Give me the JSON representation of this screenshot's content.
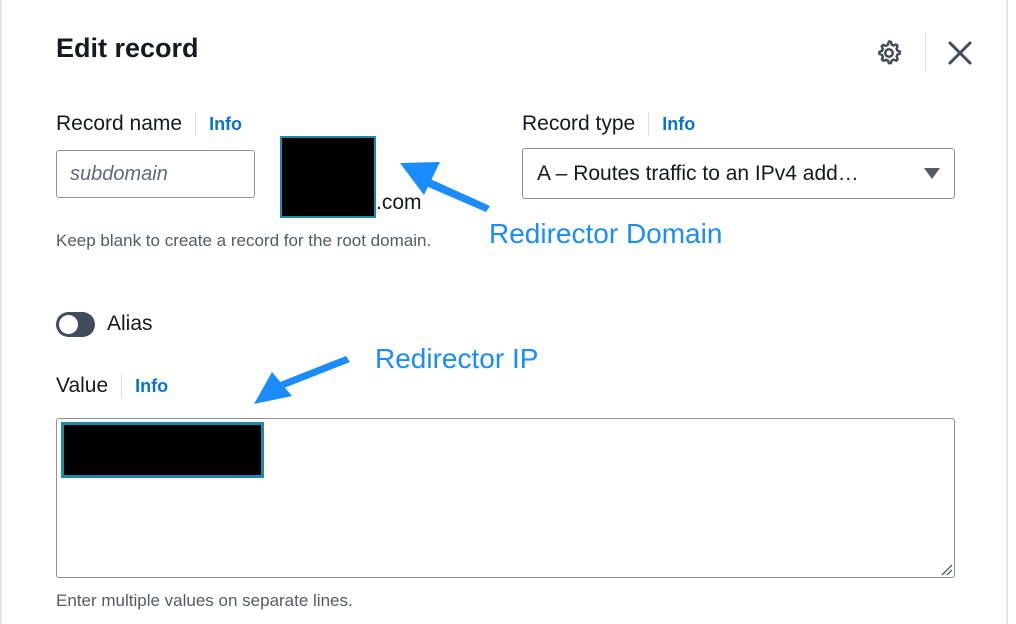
{
  "dialog": {
    "title": "Edit record",
    "header_icons": [
      "gear-icon",
      "close-icon"
    ]
  },
  "record_name": {
    "label": "Record name",
    "info_link": "Info",
    "input_value": "",
    "input_placeholder": "subdomain",
    "domain_suffix": ".com",
    "domain_redacted": true,
    "hint": "Keep blank to create a record for the root domain."
  },
  "record_type": {
    "label": "Record type",
    "info_link": "Info",
    "selected": "A – Routes traffic to an IPv4 add…"
  },
  "alias": {
    "label": "Alias",
    "enabled": false
  },
  "value": {
    "label": "Value",
    "info_link": "Info",
    "value_redacted": true,
    "hint": "Enter multiple values on separate lines."
  },
  "annotations": {
    "domain_callout": "Redirector Domain",
    "ip_callout": "Redirector IP",
    "color": "#1a8cff"
  },
  "colors": {
    "link": "#0972d3",
    "redaction_border": "#1e8aa8",
    "toggle_off": "#414d5c"
  }
}
